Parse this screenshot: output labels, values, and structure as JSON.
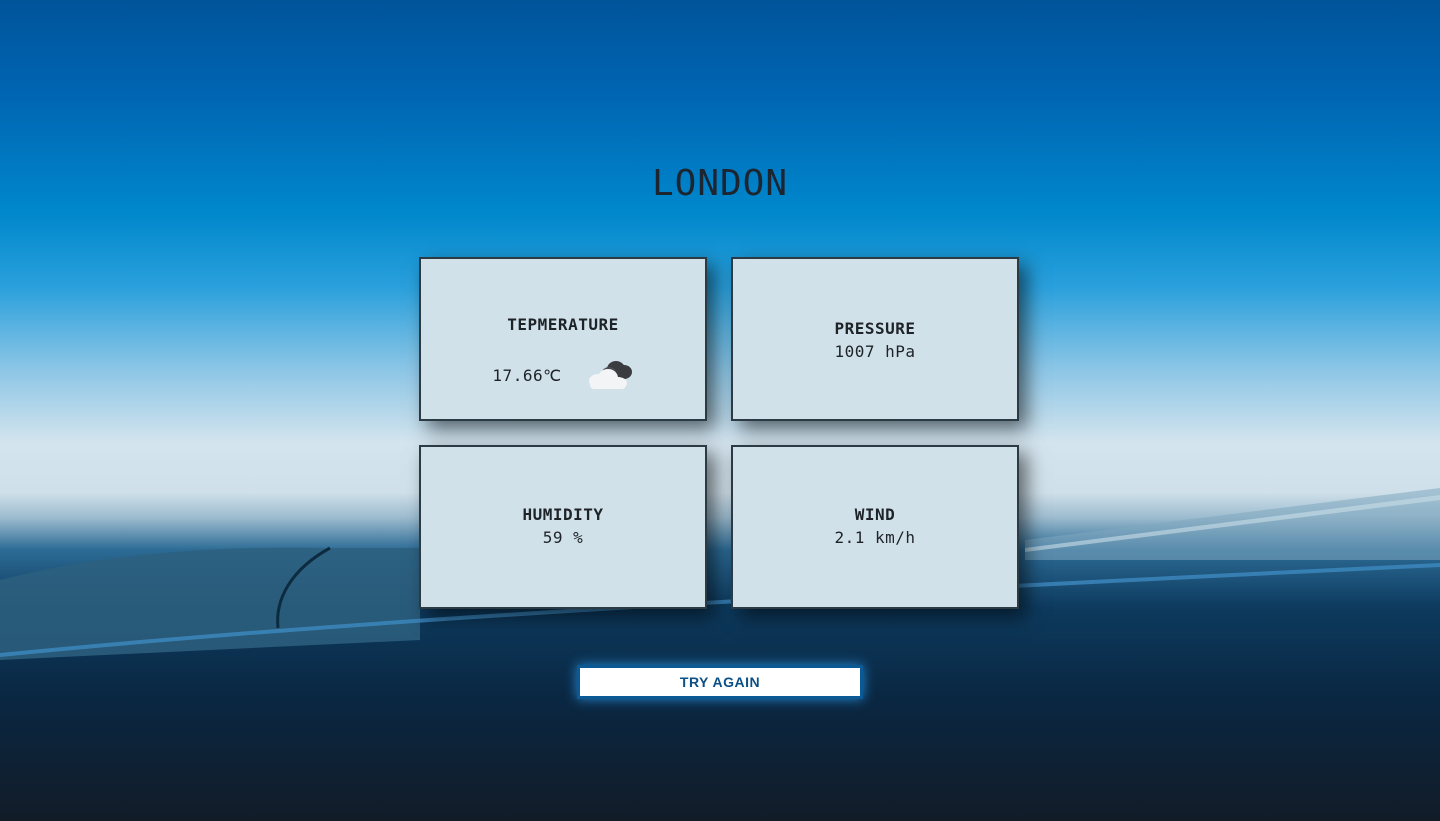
{
  "city": "LONDON",
  "cards": {
    "temperature": {
      "label": "TEPMERATURE",
      "value": "17.66℃",
      "icon": "cloud-icon"
    },
    "pressure": {
      "label": "PRESSURE",
      "value": "1007 hPa"
    },
    "humidity": {
      "label": "HUMIDITY",
      "value": "59 %"
    },
    "wind": {
      "label": "WIND",
      "value": "2.1 km/h"
    }
  },
  "button": {
    "label": "TRY AGAIN"
  },
  "colors": {
    "card_bg": "#d1e1e9",
    "card_border": "#2c3a44",
    "button_border": "#0b5a96",
    "button_text": "#0c4f86"
  }
}
